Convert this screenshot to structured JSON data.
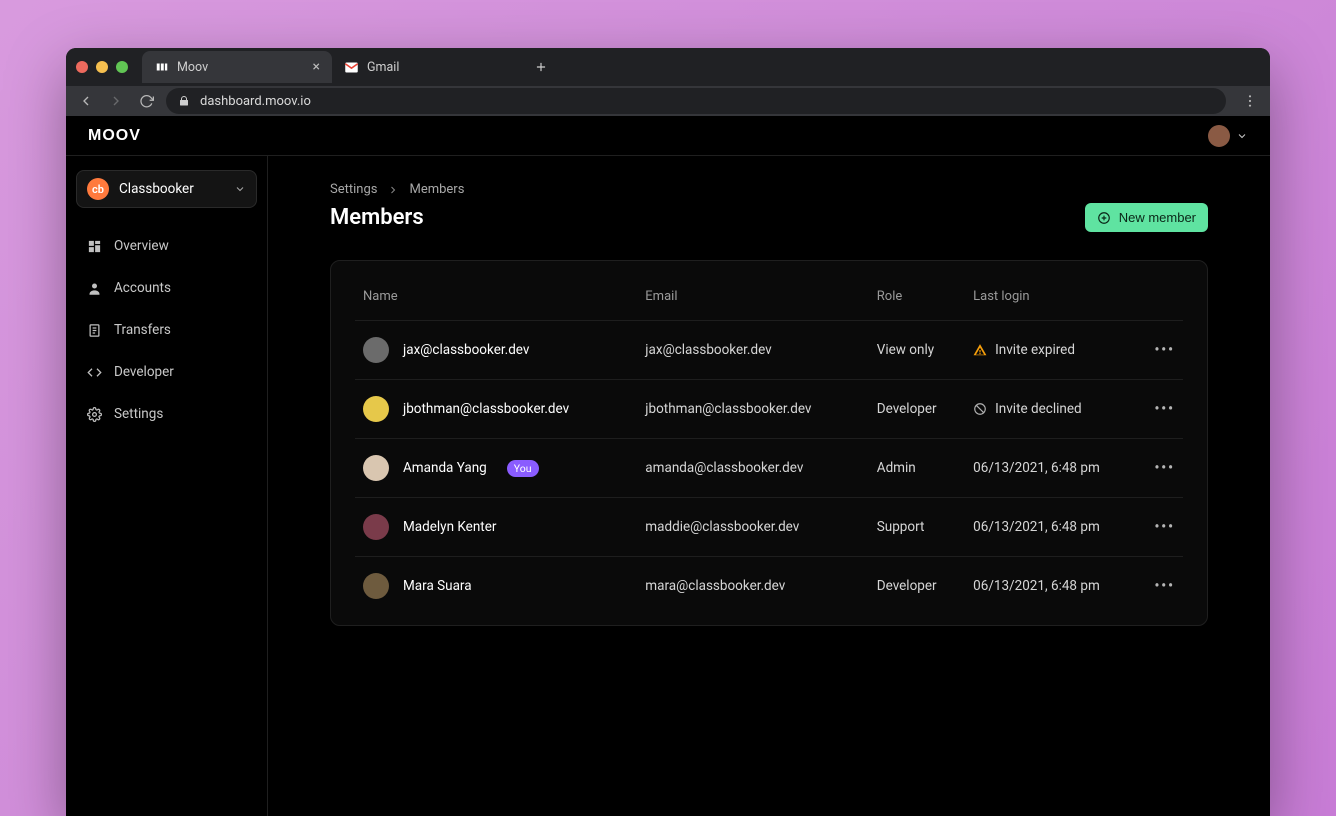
{
  "browser": {
    "tabs": [
      {
        "title": "Moov",
        "favicon": "moov",
        "active": true,
        "closeable": true
      },
      {
        "title": "Gmail",
        "favicon": "gmail",
        "active": false,
        "closeable": false
      }
    ],
    "url": "dashboard.moov.io"
  },
  "app": {
    "logo": "moov",
    "org": {
      "name": "Classbooker",
      "badge": "cb"
    }
  },
  "sidebar": {
    "items": [
      {
        "label": "Overview",
        "icon": "dashboard-icon"
      },
      {
        "label": "Accounts",
        "icon": "person-icon"
      },
      {
        "label": "Transfers",
        "icon": "receipt-icon"
      },
      {
        "label": "Developer",
        "icon": "code-icon"
      },
      {
        "label": "Settings",
        "icon": "gear-icon"
      }
    ]
  },
  "page": {
    "breadcrumb": [
      "Settings",
      "Members"
    ],
    "title": "Members",
    "primary_button": "New member"
  },
  "table": {
    "columns": [
      "Name",
      "Email",
      "Role",
      "Last login"
    ],
    "rows": [
      {
        "name": "jax@classbooker.dev",
        "email": "jax@classbooker.dev",
        "role": "View only",
        "last_login": "Invite expired",
        "status": "expired",
        "you": false,
        "avatar_color": "#6b6b6b"
      },
      {
        "name": "jbothman@classbooker.dev",
        "email": "jbothman@classbooker.dev",
        "role": "Developer",
        "last_login": "Invite declined",
        "status": "declined",
        "you": false,
        "avatar_color": "#e6c84a"
      },
      {
        "name": "Amanda Yang",
        "email": "amanda@classbooker.dev",
        "role": "Admin",
        "last_login": "06/13/2021, 6:48 pm",
        "status": "ok",
        "you": true,
        "avatar_color": "#d9c6b0"
      },
      {
        "name": "Madelyn Kenter",
        "email": "maddie@classbooker.dev",
        "role": "Support",
        "last_login": "06/13/2021, 6:48 pm",
        "status": "ok",
        "you": false,
        "avatar_color": "#7a3b4a"
      },
      {
        "name": "Mara Suara",
        "email": "mara@classbooker.dev",
        "role": "Developer",
        "last_login": "06/13/2021, 6:48 pm",
        "status": "ok",
        "you": false,
        "avatar_color": "#6e5b3e"
      }
    ],
    "you_label": "You"
  }
}
